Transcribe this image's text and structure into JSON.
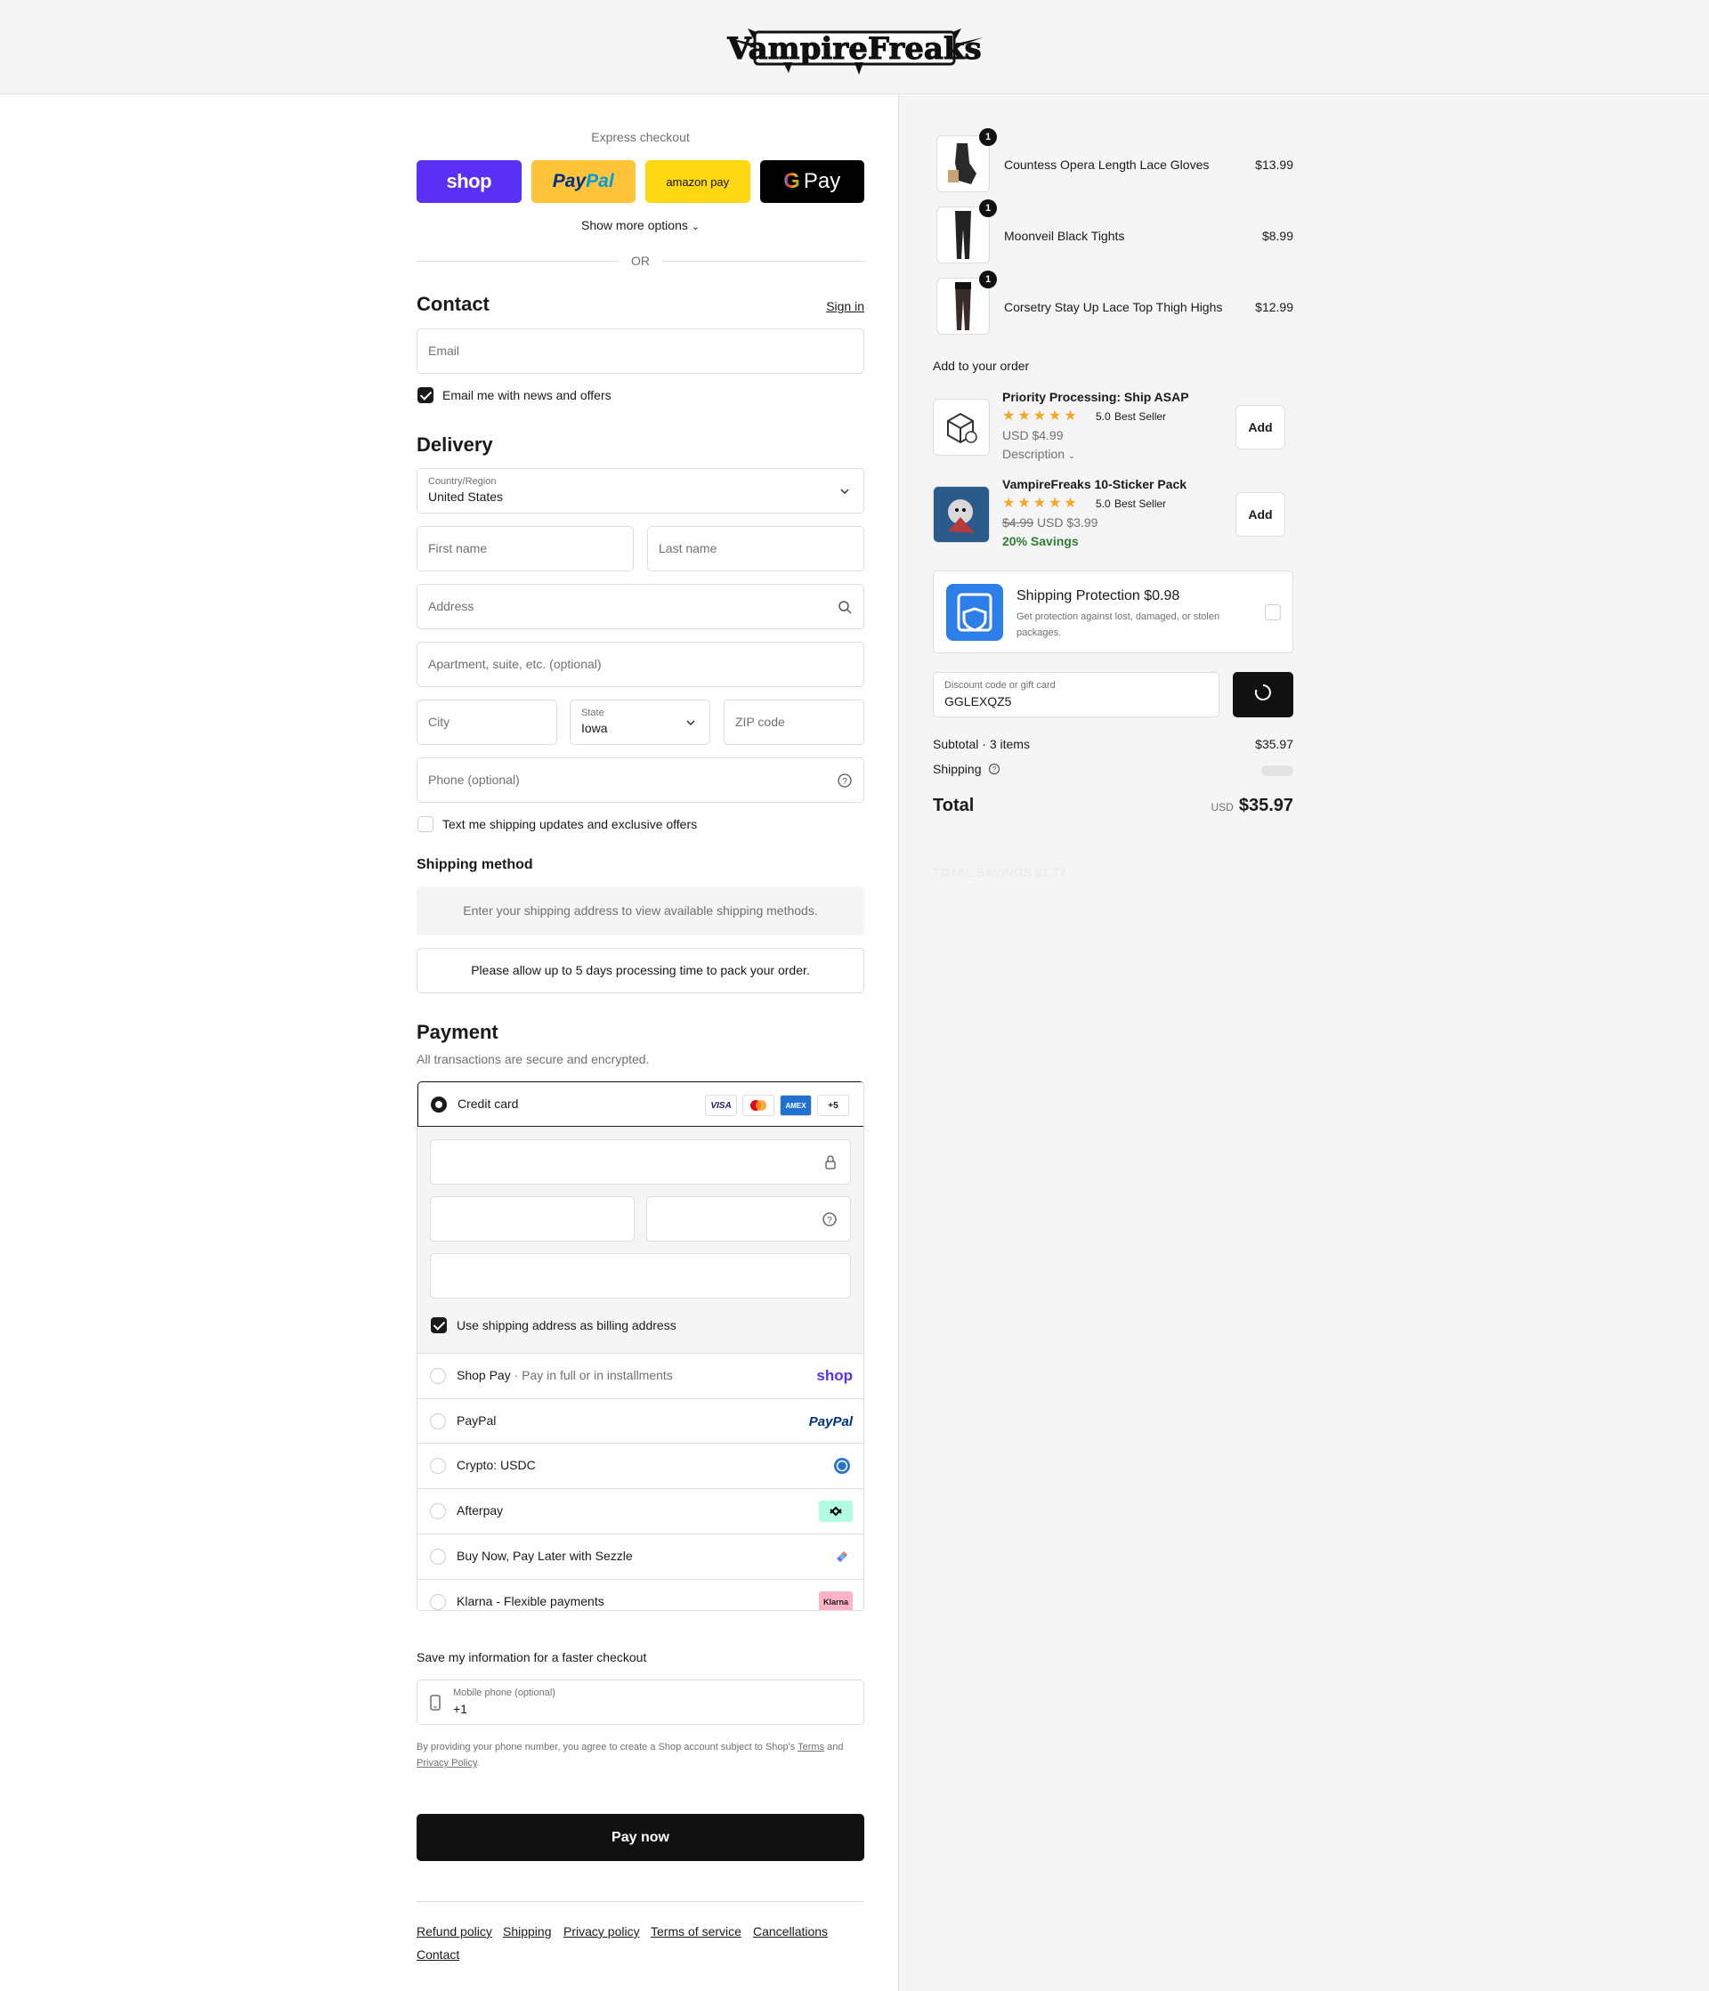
{
  "brand": {
    "logo_text": "VampireFreaks"
  },
  "express": {
    "title": "Express checkout",
    "shop_label": "shop",
    "paypal_label_1": "Pay",
    "paypal_label_2": "Pal",
    "amazon_label": "amazon pay",
    "gpay_label": "Pay",
    "show_more": "Show more options",
    "or": "OR"
  },
  "contact": {
    "title": "Contact",
    "sign_in": "Sign in",
    "email_placeholder": "Email",
    "news_label": "Email me with news and offers",
    "news_checked": true
  },
  "delivery": {
    "title": "Delivery",
    "country_label": "Country/Region",
    "country_value": "United States",
    "first_name": "First name",
    "last_name": "Last name",
    "address": "Address",
    "apartment": "Apartment, suite, etc. (optional)",
    "city": "City",
    "state_label": "State",
    "state_value": "Iowa",
    "zip": "ZIP code",
    "phone": "Phone (optional)",
    "sms_label": "Text me shipping updates and exclusive offers",
    "sms_checked": false
  },
  "shipping_method": {
    "title": "Shipping method",
    "notice": "Enter your shipping address to view available shipping methods.",
    "processing": "Please allow up to 5 days processing time to pack your order."
  },
  "payment": {
    "title": "Payment",
    "subtitle": "All transactions are secure and encrypted.",
    "credit_card": "Credit card",
    "more_cards": "+5",
    "billing_label": "Use shipping address as billing address",
    "billing_checked": true,
    "options": [
      {
        "label": "Shop Pay",
        "sub": "Pay in full or in installments",
        "logo": "shop"
      },
      {
        "label": "PayPal",
        "sub": "",
        "logo": "PayPal"
      },
      {
        "label": "Crypto: USDC",
        "sub": "",
        "logo": "usdc-icon"
      },
      {
        "label": "Afterpay",
        "sub": "",
        "logo": "afterpay-icon"
      },
      {
        "label": "Buy Now, Pay Later with Sezzle",
        "sub": "",
        "logo": "sezzle-icon"
      },
      {
        "label": "Klarna - Flexible payments",
        "sub": "",
        "logo": "Klarna"
      }
    ]
  },
  "save_info": {
    "title": "Save my information for a faster checkout",
    "mobile_label": "Mobile phone (optional)",
    "mobile_value": "+1",
    "legal_1": "By providing your phone number, you agree to create a Shop account subject to Shop's",
    "terms": "Terms",
    "and": "and",
    "privacy": "Privacy Policy"
  },
  "pay_now": "Pay now",
  "footer_links": [
    "Refund policy",
    "Shipping",
    "Privacy policy",
    "Terms of service",
    "Cancellations",
    "Contact"
  ],
  "cart": {
    "items": [
      {
        "name": "Countess Opera Length Lace Gloves",
        "price": "$13.99",
        "qty": "1"
      },
      {
        "name": "Moonveil Black Tights",
        "price": "$8.99",
        "qty": "1"
      },
      {
        "name": "Corsetry Stay Up Lace Top Thigh Highs",
        "price": "$12.99",
        "qty": "1"
      }
    ],
    "add_title": "Add to your order",
    "upsells": [
      {
        "title": "Priority Processing: Ship ASAP",
        "stars": "★★★★★",
        "rating": "5.0",
        "badge": "Best Seller",
        "price": "USD $4.99",
        "extra": "Description",
        "add": "Add"
      },
      {
        "title": "VampireFreaks 10-Sticker Pack",
        "stars": "★★★★★",
        "rating": "5.0",
        "badge": "Best Seller",
        "old_price": "$4.99",
        "price": "USD $3.99",
        "savings": "20% Savings",
        "add": "Add"
      }
    ],
    "protection": {
      "title": "Shipping Protection $0.98",
      "desc": "Get protection against lost, damaged, or stolen packages."
    },
    "discount_label": "Discount code or gift card",
    "discount_value": "GGLEXQZ5",
    "subtotal_label": "Subtotal · 3 items",
    "subtotal_value": "$35.97",
    "shipping_label": "Shipping",
    "total_label": "Total",
    "currency": "USD",
    "total_value": "$35.97",
    "total_savings": "TOTAL SAVINGS $1.77"
  },
  "colors": {
    "shop": "#5a31f4",
    "paypal": "#ffc439",
    "amazon": "#ffd814",
    "star": "#f5a623",
    "savings": "#2e7d32"
  }
}
